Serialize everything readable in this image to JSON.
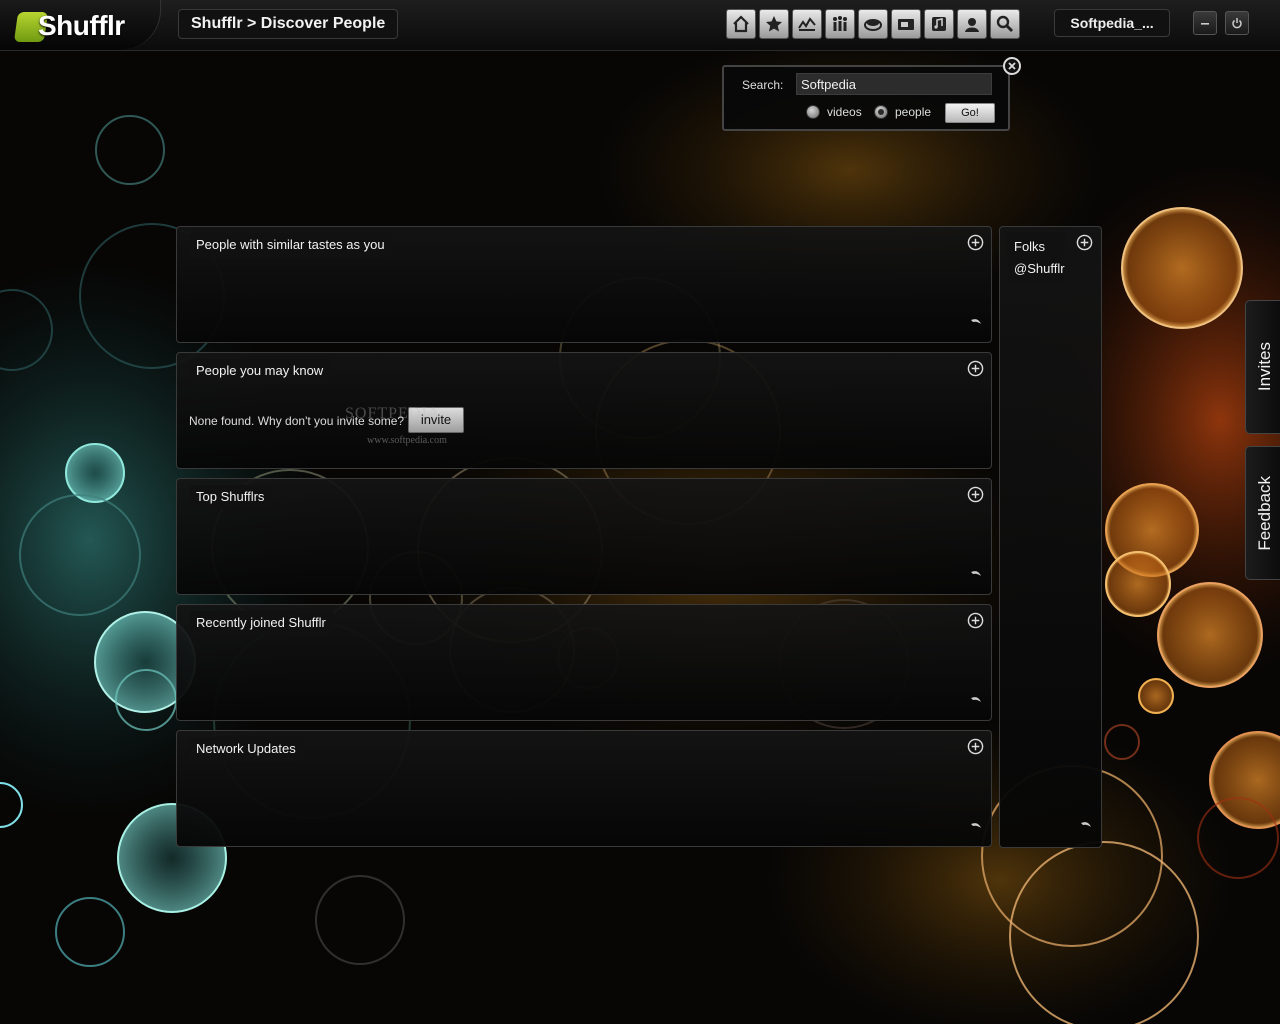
{
  "app": {
    "name": "Shufflr"
  },
  "header": {
    "breadcrumb": "Shufflr > Discover People",
    "nav_icons": [
      "home-icon",
      "star-icon",
      "trending-icon",
      "people-icon",
      "disc-icon",
      "tv-icon",
      "music-icon",
      "profile-icon",
      "search-icon"
    ],
    "user_label": "Softpedia_..."
  },
  "search": {
    "label": "Search:",
    "value": "Softpedia",
    "options": [
      "videos",
      "people"
    ],
    "selected": "people",
    "go_label": "Go!"
  },
  "panels": [
    {
      "title": "People with similar tastes as you"
    },
    {
      "title": "People you may know",
      "empty_text": "None found. Why don't you invite some?",
      "invite_label": "invite"
    },
    {
      "title": "Top Shufflrs"
    },
    {
      "title": "Recently joined Shufflr"
    },
    {
      "title": "Network Updates"
    }
  ],
  "watermark": {
    "text": "SOFTPEDIA",
    "url": "www.softpedia.com"
  },
  "folks": {
    "title": "Folks",
    "items": [
      "@Shufflr"
    ]
  },
  "side_tabs": [
    "Invites",
    "Feedback"
  ]
}
